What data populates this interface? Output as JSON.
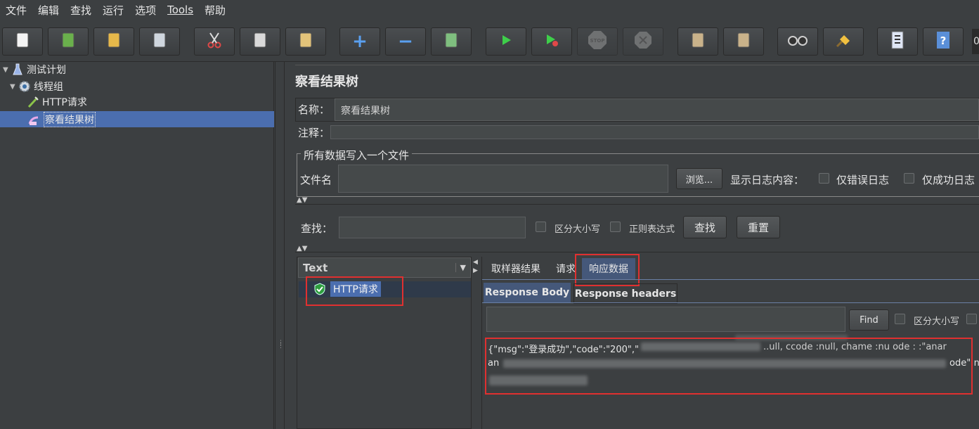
{
  "menu": [
    "文件",
    "编辑",
    "查找",
    "运行",
    "选项",
    "Tools",
    "帮助"
  ],
  "toolbar": {
    "buttons": [
      {
        "name": "new-icon"
      },
      {
        "name": "templates-icon"
      },
      {
        "name": "open-icon"
      },
      {
        "name": "save-icon"
      },
      {
        "name": "cut-icon"
      },
      {
        "name": "copy-icon"
      },
      {
        "name": "paste-icon"
      },
      {
        "name": "expand-icon",
        "glyph": "+"
      },
      {
        "name": "collapse-icon",
        "glyph": "−"
      },
      {
        "name": "toggle-icon"
      },
      {
        "name": "start-icon"
      },
      {
        "name": "start-no-pause-icon"
      },
      {
        "name": "stop-icon",
        "glyph": "STOP"
      },
      {
        "name": "shutdown-icon"
      },
      {
        "name": "clear-icon"
      },
      {
        "name": "clear-all-icon"
      },
      {
        "name": "search-icon"
      },
      {
        "name": "reset-search-icon"
      },
      {
        "name": "function-helper-icon"
      },
      {
        "name": "help-icon",
        "glyph": "?"
      }
    ],
    "counter": "0"
  },
  "tree": {
    "items": [
      {
        "label": "测试计划",
        "icon": "flask-icon"
      },
      {
        "label": "线程组",
        "icon": "gear-icon"
      },
      {
        "label": "HTTP请求",
        "icon": "pipette-icon"
      },
      {
        "label": "察看结果树",
        "icon": "results-tree-icon"
      }
    ]
  },
  "panel": {
    "title": "察看结果树",
    "name_label": "名称：",
    "name_value": "察看结果树",
    "comment_label": "注释：",
    "comment_value": "",
    "file_section_title": "所有数据写入一个文件",
    "filename_label": "文件名",
    "filename_value": "",
    "browse_label": "浏览...",
    "log_label": "显示日志内容：",
    "errors_only_label": "仅错误日志",
    "success_only_label": "仅成功日志",
    "search_label": "查找：",
    "search_value": "",
    "case_sensitive_label": "区分大小写",
    "regex_label": "正则表达式",
    "find_button": "查找",
    "reset_button": "重置"
  },
  "results": {
    "renderer": "Text",
    "sample_label": "HTTP请求",
    "tabs": [
      "取样器结果",
      "请求",
      "响应数据"
    ],
    "sub_tabs": [
      "Response Body",
      "Response headers"
    ],
    "find_button": "Find",
    "find_value": "",
    "find_case_label": "区分大小写",
    "body_line1_prefix": "{\"msg\":\"登录成功\",\"code\":\"200\",\"",
    "body_line1_tail": "..ull, ccode :null, chame :nu   ode :   :\"anar",
    "body_line2_prefix": "an",
    "body_line2_tail": "ode\":null"
  },
  "colors": {
    "accent_selection": "#4b6eaf",
    "highlight_box": "#e03030"
  }
}
